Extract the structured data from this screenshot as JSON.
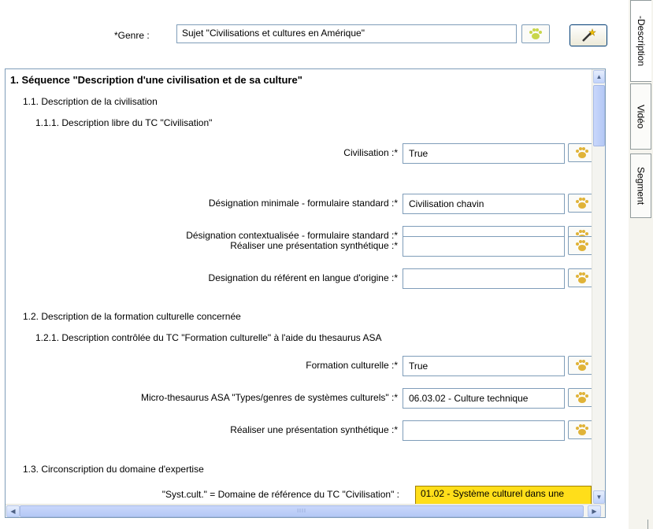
{
  "genre": {
    "label": "*Genre :",
    "value": "Sujet \"Civilisations et cultures en Amérique\"",
    "paw_icon": "paw-icon",
    "wand_icon": "magic-wand-icon"
  },
  "form": {
    "section1": {
      "title": "1. Séquence \"Description d'une civilisation et de sa culture\""
    },
    "section1_1": {
      "title": "1.1. Description de la civilisation"
    },
    "section1_1_1": {
      "title": "1.1.1. Description libre du TC \"Civilisation\""
    },
    "fields_1_1_1": [
      {
        "label": "Civilisation :*",
        "value": "True"
      },
      {
        "label": "Désignation minimale - formulaire standard :*",
        "value": "Civilisation chavin"
      },
      {
        "label": "Désignation contextualisée - formulaire standard :*",
        "value": ""
      },
      {
        "label": "Réaliser une présentation synthétique :*",
        "value": ""
      },
      {
        "label": "Designation du référent en langue d'origine :*",
        "value": ""
      }
    ],
    "section1_2": {
      "title": "1.2. Description de la formation culturelle concernée"
    },
    "section1_2_1": {
      "title": "1.2.1. Description contrôlée du TC \"Formation culturelle\" à l'aide du thesaurus ASA"
    },
    "fields_1_2_1": [
      {
        "label": "Formation culturelle :*",
        "value": "True"
      },
      {
        "label": "Micro-thesaurus ASA \"Types/genres de systèmes culturels\" :*",
        "value": "06.03.02 - Culture technique"
      },
      {
        "label": "Réaliser une présentation synthétique :*",
        "value": ""
      }
    ],
    "section1_3": {
      "title": "1.3. Circonscription du domaine d'expertise"
    },
    "fields_1_3": [
      {
        "label": "\"Syst.cult.\" = Domaine de référence du TC \"Civilisation\" :",
        "value": "01.02 - Système culturel dans une"
      }
    ],
    "highlight_color": "#ffde1a"
  },
  "scrollbars": {
    "up": "▲",
    "down": "▼",
    "left": "◀",
    "right": "▶",
    "grip": "IIII"
  },
  "side_tabs": [
    {
      "label": "-Description"
    },
    {
      "label": "Vidéo"
    },
    {
      "label": "Segment"
    }
  ]
}
